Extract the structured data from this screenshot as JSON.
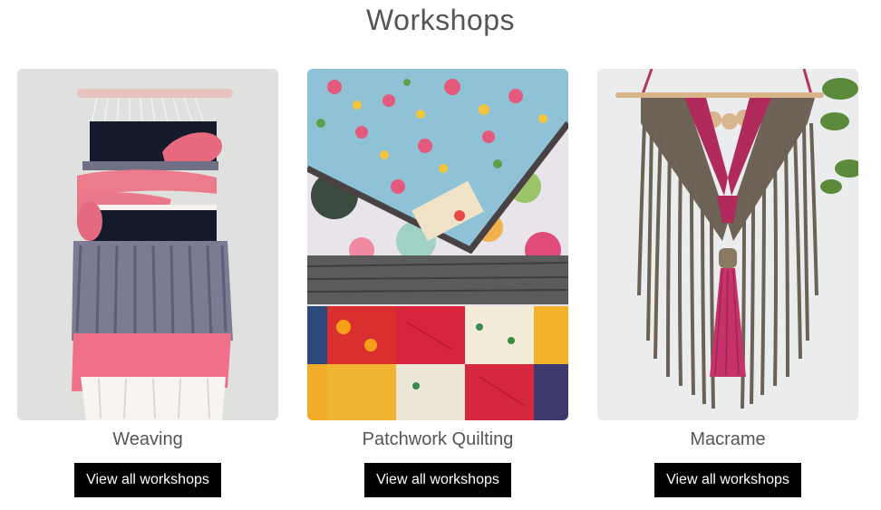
{
  "page": {
    "title": "Workshops"
  },
  "workshops": [
    {
      "title": "Weaving",
      "button_label": "View all workshops",
      "image": "weaving-wall-hanging"
    },
    {
      "title": "Patchwork Quilting",
      "button_label": "View all workshops",
      "image": "patchwork-quilt"
    },
    {
      "title": "Macrame",
      "button_label": "View all workshops",
      "image": "macrame-wall-hanging"
    }
  ],
  "colors": {
    "button_bg": "#000000",
    "button_text": "#ffffff",
    "text": "#555555"
  }
}
